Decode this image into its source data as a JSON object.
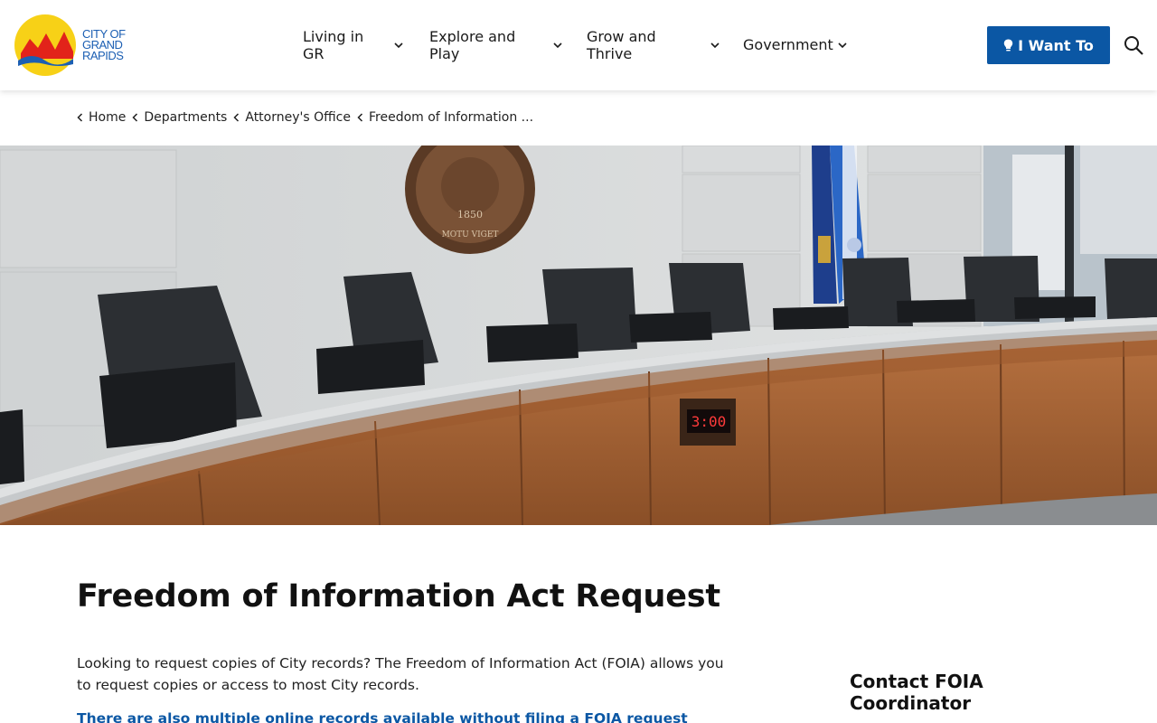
{
  "header": {
    "logo_lines": [
      "CITY OF",
      "GRAND",
      "RAPIDS"
    ],
    "nav": [
      {
        "label": "Living in\nGR"
      },
      {
        "label": "Explore and\nPlay"
      },
      {
        "label": "Grow and\nThrive"
      },
      {
        "label": "Government"
      }
    ],
    "i_want_label": "I Want To",
    "icons": [
      "lightbulb-icon",
      "search-icon",
      "chevron-down-icon"
    ]
  },
  "breadcrumb": [
    "Home",
    "Departments",
    "Attorney's Office",
    "Freedom of Information ..."
  ],
  "hero": {
    "timer_display": "3:00",
    "seal_year": "1850",
    "seal_motto": "MOTU VIGET"
  },
  "main": {
    "title": "Freedom of Information Act Request",
    "intro": "Looking to request copies of City records? The Freedom of Information Act (FOIA) allows you to request copies or access to most City records.",
    "link_text": "There are also multiple online records available without filing a FOIA request"
  },
  "sidebar": {
    "title": "Contact FOIA Coordinator"
  },
  "colors": {
    "brand_blue": "#0b57a4",
    "logo_yellow": "#f7d117",
    "logo_red": "#e2231a"
  }
}
